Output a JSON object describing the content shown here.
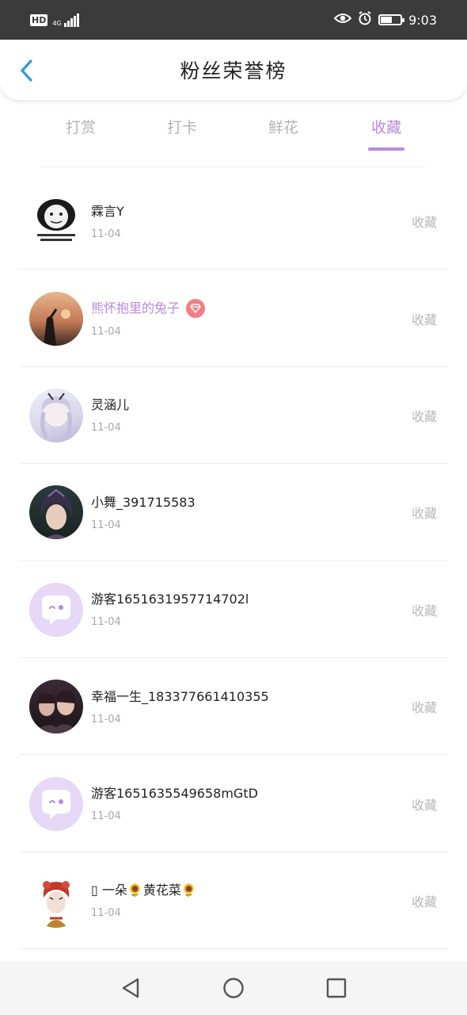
{
  "status_bar": {
    "hd": "HD",
    "network": "4G",
    "time": "9:03",
    "battery_level": 0.55,
    "icons": [
      "eye-icon",
      "alarm-icon",
      "battery-icon"
    ]
  },
  "header": {
    "title": "粉丝荣誉榜",
    "back_icon": "chevron-left-icon",
    "accent": "#2e9ae6"
  },
  "tabs": [
    {
      "label": "打赏",
      "active": false
    },
    {
      "label": "打卡",
      "active": false
    },
    {
      "label": "鲜花",
      "active": false
    },
    {
      "label": "收藏",
      "active": true
    }
  ],
  "colors": {
    "accent": "#b78ae0",
    "inactive": "#b4b4b4",
    "vip_badge": "#f07f86"
  },
  "fans": [
    {
      "name": "霖言Y",
      "date": "11-04",
      "action": "收藏",
      "vip": false,
      "avatar": "meme-panda"
    },
    {
      "name": "熊怀抱里的兔子",
      "date": "11-04",
      "action": "收藏",
      "vip": true,
      "avatar": "sunset-photo"
    },
    {
      "name": "灵涵儿",
      "date": "11-04",
      "action": "收藏",
      "vip": false,
      "avatar": "anime-girl"
    },
    {
      "name": "小舞_391715583",
      "date": "11-04",
      "action": "收藏",
      "vip": false,
      "avatar": "anime-portrait"
    },
    {
      "name": "游客1651631957714702l",
      "date": "11-04",
      "action": "收藏",
      "vip": false,
      "avatar": "default-chat"
    },
    {
      "name": "幸福一生_183377661410355",
      "date": "11-04",
      "action": "收藏",
      "vip": false,
      "avatar": "group-photo"
    },
    {
      "name": "游客1651635549658mGtD",
      "date": "11-04",
      "action": "收藏",
      "vip": false,
      "avatar": "default-chat"
    },
    {
      "name": "▯ 一朵🌻黄花菜🌻",
      "date": "11-04",
      "action": "收藏",
      "vip": false,
      "avatar": "opera-character"
    }
  ],
  "nav": {
    "back": "back-triangle-icon",
    "home": "home-circle-icon",
    "recent": "recent-square-icon"
  }
}
